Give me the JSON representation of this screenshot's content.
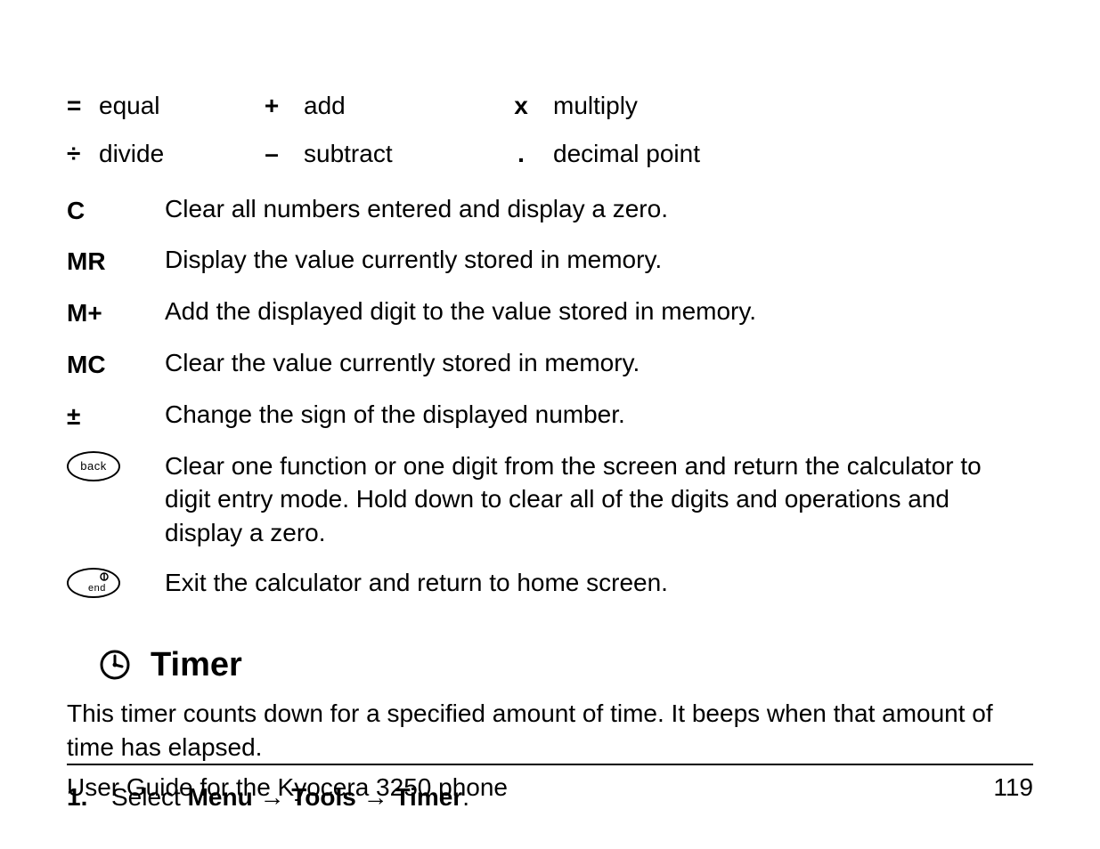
{
  "operators": {
    "row1": [
      {
        "sym": "=",
        "label": "equal"
      },
      {
        "sym": "+",
        "label": "add"
      },
      {
        "sym": "x",
        "label": "multiply"
      }
    ],
    "row2": [
      {
        "sym": "÷",
        "label": "divide"
      },
      {
        "sym": "–",
        "label": "subtract"
      },
      {
        "sym": ".",
        "label": "decimal point"
      }
    ]
  },
  "keys": [
    {
      "sym": "C",
      "desc": "Clear all numbers entered and display a zero."
    },
    {
      "sym": "MR",
      "desc": "Display the value currently stored in memory."
    },
    {
      "sym": "M+",
      "desc": "Add the displayed digit to the value stored in memory."
    },
    {
      "sym": "MC",
      "desc": "Clear the value currently stored in memory."
    },
    {
      "sym": "±",
      "desc": "Change the sign of the displayed number."
    },
    {
      "btn": "back",
      "desc": "Clear one function or one digit from the screen and return the calculator to digit entry mode. Hold down to clear all of the digits and operations and display a zero."
    },
    {
      "btn": "end",
      "desc": "Exit the calculator and return to home screen."
    }
  ],
  "timer": {
    "heading": "Timer",
    "desc": "This timer counts down for a specified amount of time. It beeps when that amount of time has elapsed."
  },
  "step": {
    "num": "1.",
    "prefix": "Select ",
    "menu": "Menu",
    "arrow": " → ",
    "tools": "Tools",
    "timer": "Timer",
    "suffix": "."
  },
  "footer": {
    "left": "User Guide for the Kyocera 3250 phone",
    "right": "119"
  }
}
